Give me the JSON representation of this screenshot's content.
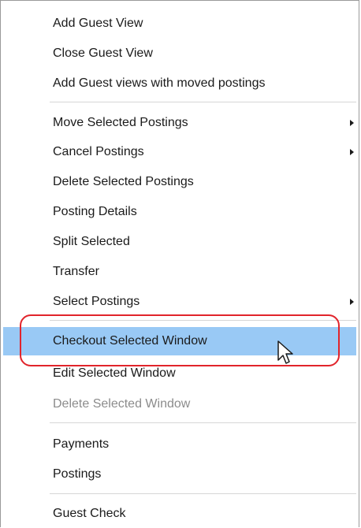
{
  "menu": {
    "items": [
      {
        "label": "Add Guest View",
        "submenu": false,
        "disabled": false
      },
      {
        "label": "Close Guest View",
        "submenu": false,
        "disabled": false
      },
      {
        "label": "Add Guest views with moved postings",
        "submenu": false,
        "disabled": false
      },
      {
        "label": "Move Selected Postings",
        "submenu": true,
        "disabled": false
      },
      {
        "label": "Cancel Postings",
        "submenu": true,
        "disabled": false
      },
      {
        "label": "Delete Selected Postings",
        "submenu": false,
        "disabled": false
      },
      {
        "label": "Posting Details",
        "submenu": false,
        "disabled": false
      },
      {
        "label": "Split Selected",
        "submenu": false,
        "disabled": false
      },
      {
        "label": "Transfer",
        "submenu": false,
        "disabled": false
      },
      {
        "label": "Select Postings",
        "submenu": true,
        "disabled": false
      },
      {
        "label": "Checkout Selected Window",
        "submenu": false,
        "disabled": false,
        "highlighted": true
      },
      {
        "label": "Edit Selected Window",
        "submenu": false,
        "disabled": false
      },
      {
        "label": "Delete Selected Window",
        "submenu": false,
        "disabled": true
      },
      {
        "label": "Payments",
        "submenu": false,
        "disabled": false
      },
      {
        "label": "Postings",
        "submenu": false,
        "disabled": false
      },
      {
        "label": "Guest Check",
        "submenu": false,
        "disabled": false
      }
    ]
  },
  "colors": {
    "highlight": "#99c9f5",
    "callout": "#e1242b",
    "disabled_text": "#8c8c8c"
  },
  "icons": {
    "submenu": "chevron-right-icon",
    "cursor": "mouse-pointer-icon"
  }
}
